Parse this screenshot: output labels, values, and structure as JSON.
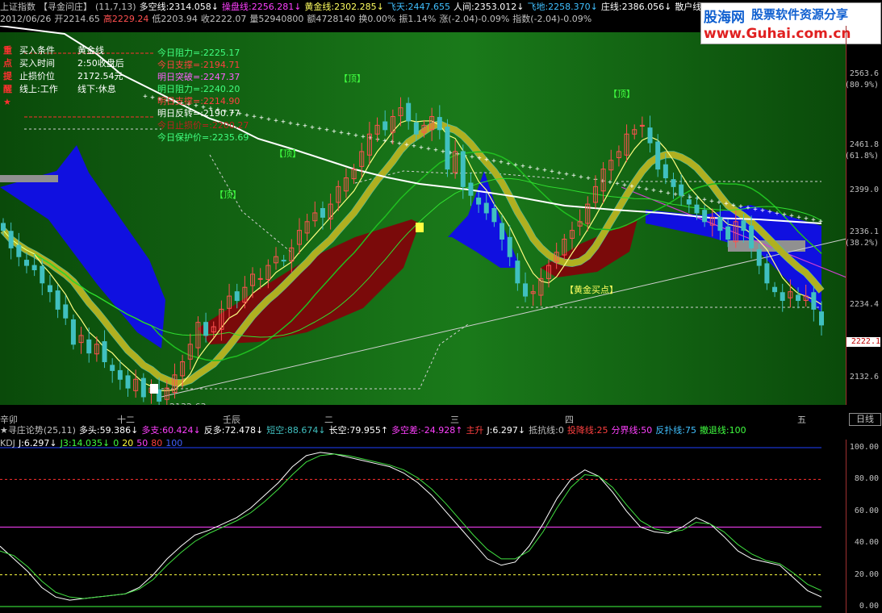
{
  "colors": {
    "up": "#ff5050",
    "down": "#40c0c0",
    "bg_green": "#106010",
    "blue_cloud": "#1010e0",
    "red_cloud": "#7a0a0a",
    "yellow_band": "#b0b020",
    "white_line": "#ffffff"
  },
  "logo": {
    "site": "股海网",
    "slogan": "股票软件资源分享",
    "url": "www.Guhai.com.cn"
  },
  "header": {
    "line1": [
      {
        "text": "上证指数",
        "color": "#c0c0c0"
      },
      {
        "text": "【寻金问庄】",
        "color": "#c0c0c0"
      },
      {
        "text": "(11,7,13)",
        "color": "#c0c0c0"
      },
      {
        "text": "多空线:2314.058↓",
        "color": "#ffffff"
      },
      {
        "text": "操盘线:2256.281↓",
        "color": "#ff40ff"
      },
      {
        "text": "黄金线:2302.285↓",
        "color": "#ffff60"
      },
      {
        "text": "飞天:2447.655",
        "color": "#40c0ff"
      },
      {
        "text": "人间:2353.012↓",
        "color": "#ffffff"
      },
      {
        "text": "飞地:2258.370↓",
        "color": "#40c0ff"
      },
      {
        "text": "庄线:2386.056↓",
        "color": "#ffffff"
      },
      {
        "text": "散户线",
        "color": "#ffffff"
      }
    ],
    "line2": [
      {
        "text": "2012/06/26",
        "color": "#c0c0c0"
      },
      {
        "text": "开2214.65",
        "color": "#c0c0c0"
      },
      {
        "text": "高2229.24",
        "color": "#ff5050"
      },
      {
        "text": "低2203.94",
        "color": "#c0c0c0"
      },
      {
        "text": "收2222.07",
        "color": "#c0c0c0"
      },
      {
        "text": "量52940800",
        "color": "#c0c0c0"
      },
      {
        "text": "额4728140",
        "color": "#c0c0c0"
      },
      {
        "text": "换0.00%",
        "color": "#c0c0c0"
      },
      {
        "text": "振1.14%",
        "color": "#c0c0c0"
      },
      {
        "text": "涨(-2.04)-0.09%",
        "color": "#c0c0c0"
      },
      {
        "text": "指数(-2.04)-0.09%",
        "color": "#c0c0c0"
      }
    ]
  },
  "info_block": {
    "rows": [
      {
        "label": "买入条件",
        "value": "黄金线"
      },
      {
        "label": "买入时间",
        "value": "2:50收盘后"
      },
      {
        "label": "止损价位",
        "value": "2172.54元"
      },
      {
        "label": "线上:工作",
        "value": "线下:休息"
      }
    ],
    "side_chars": [
      "重",
      "点",
      "提",
      "醒",
      "★"
    ]
  },
  "levels": [
    {
      "text": "今日阻力=:2225.17",
      "color": "#40ff80"
    },
    {
      "text": "今日支撑=:2194.71",
      "color": "#ff4040"
    },
    {
      "text": "明日突破=:2247.37",
      "color": "#ff60ff"
    },
    {
      "text": "明日阻力=:2240.20",
      "color": "#40ff80"
    },
    {
      "text": "明日支撑=:2214.90",
      "color": "#ff4040"
    },
    {
      "text": "明日反转=:2190.77",
      "color": "#ffffff"
    },
    {
      "text": "今日止损价=:2200.27",
      "color": "#c02020"
    },
    {
      "text": "今日保护价=:2235.69",
      "color": "#40ff80"
    }
  ],
  "annotations": {
    "top_label": "【顶】",
    "gold_buy": "【黄金买点】",
    "low_label": "2132.63"
  },
  "price_axis": [
    "2563.6",
    "(80.9%)",
    "2461.8",
    "(61.8%)",
    "2399.0",
    "2336.1",
    "(38.2%)",
    "2234.4",
    "2132.6"
  ],
  "current_price": "2222.1",
  "date_axis": [
    "辛卯",
    "十二",
    "壬辰",
    "二",
    "三",
    "四",
    "五"
  ],
  "period_button": "日线",
  "sub_header": [
    {
      "text": "★寻庄论势(25,11)",
      "color": "#c0c0c0"
    },
    {
      "text": "多头:59.386↓",
      "color": "#ffffff"
    },
    {
      "text": "多支:60.424↓",
      "color": "#ff40ff"
    },
    {
      "text": "反多:72.478↓",
      "color": "#ffffff"
    },
    {
      "text": "短空:88.674↓",
      "color": "#40c0c0"
    },
    {
      "text": "长空:79.955↑",
      "color": "#ffffff"
    },
    {
      "text": "多空差:-24.928↑",
      "color": "#ff40ff"
    },
    {
      "text": "主升",
      "color": "#ff4040"
    },
    {
      "text": "J:6.297↓",
      "color": "#ffffff"
    },
    {
      "text": "抵抗线:0",
      "color": "#c0c0c0"
    },
    {
      "text": "投降线:25",
      "color": "#ff4040"
    },
    {
      "text": "分界线:50",
      "color": "#ff40ff"
    },
    {
      "text": "反扑线:75",
      "color": "#40c0ff"
    },
    {
      "text": "撤退线:100",
      "color": "#40ff40"
    }
  ],
  "kdj_header": [
    {
      "text": "KDJ",
      "color": "#c0c0c0"
    },
    {
      "text": "J:6.297↓",
      "color": "#ffffff"
    },
    {
      "text": "J3:14.035↓",
      "color": "#40ff40"
    },
    {
      "text": "0",
      "color": "#40ff40"
    },
    {
      "text": "20",
      "color": "#ffff40"
    },
    {
      "text": "50",
      "color": "#ff40ff"
    },
    {
      "text": "80",
      "color": "#ff4040"
    },
    {
      "text": "100",
      "color": "#4060ff"
    }
  ],
  "kdj_axis": [
    "100.00",
    "80.00",
    "60.00",
    "40.00",
    "20.00",
    "0.00"
  ],
  "chart_data": [
    {
      "type": "candlestick",
      "title": "上证指数",
      "ylim": [
        2132.6,
        2563.6
      ],
      "closes": [
        2330,
        2310,
        2300,
        2290,
        2285,
        2270,
        2260,
        2240,
        2230,
        2200,
        2210,
        2190,
        2200,
        2180,
        2170,
        2160,
        2150,
        2160,
        2140,
        2150,
        2135,
        2150,
        2165,
        2180,
        2200,
        2225,
        2210,
        2220,
        2240,
        2255,
        2250,
        2265,
        2280,
        2275,
        2290,
        2300,
        2295,
        2310,
        2330,
        2340,
        2350,
        2345,
        2360,
        2380,
        2390,
        2400,
        2420,
        2440,
        2450,
        2445,
        2460,
        2470,
        2455,
        2440,
        2450,
        2460,
        2445,
        2400,
        2420,
        2380,
        2370,
        2360,
        2350,
        2340,
        2320,
        2300,
        2270,
        2255,
        2260,
        2275,
        2290,
        2305,
        2320,
        2330,
        2340,
        2360,
        2380,
        2400,
        2410,
        2420,
        2440,
        2445,
        2450,
        2430,
        2400,
        2390,
        2380,
        2370,
        2360,
        2350,
        2340,
        2345,
        2330,
        2320,
        2340,
        2330,
        2310,
        2290,
        2270,
        2260,
        2250,
        2260,
        2250,
        2255,
        2240,
        2222
      ]
    },
    {
      "type": "line",
      "title": "KDJ",
      "ylim": [
        0,
        100
      ],
      "series": [
        {
          "name": "J",
          "values": [
            38,
            30,
            22,
            12,
            6,
            4,
            5,
            6,
            7,
            8,
            12,
            20,
            30,
            38,
            45,
            48,
            52,
            56,
            62,
            70,
            78,
            88,
            95,
            97,
            96,
            94,
            92,
            90,
            88,
            84,
            78,
            70,
            60,
            50,
            40,
            30,
            26,
            28,
            38,
            52,
            68,
            80,
            86,
            82,
            72,
            60,
            50,
            47,
            46,
            50,
            56,
            52,
            44,
            35,
            30,
            28,
            26,
            18,
            10,
            6
          ]
        },
        {
          "name": "J3",
          "values": [
            35,
            32,
            25,
            16,
            9,
            6,
            5,
            6,
            7,
            8,
            11,
            17,
            26,
            34,
            41,
            46,
            50,
            54,
            59,
            66,
            74,
            83,
            91,
            95,
            96,
            95,
            93,
            91,
            89,
            86,
            81,
            74,
            65,
            55,
            45,
            36,
            30,
            30,
            35,
            47,
            62,
            75,
            83,
            82,
            75,
            64,
            54,
            49,
            47,
            48,
            53,
            52,
            47,
            39,
            33,
            29,
            27,
            21,
            14,
            10
          ]
        }
      ]
    }
  ]
}
